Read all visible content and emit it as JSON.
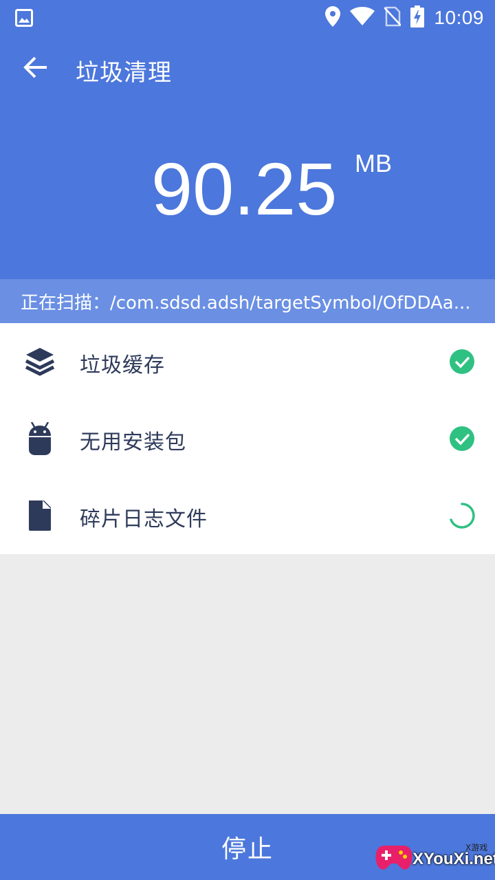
{
  "status_bar": {
    "time": "10:09",
    "icons": [
      "image-icon",
      "location-icon",
      "wifi-icon",
      "no-sim-icon",
      "battery-charging-icon"
    ]
  },
  "toolbar": {
    "title": "垃圾清理",
    "back_icon": "arrow-left-icon"
  },
  "scan_result": {
    "size_value": "90.25",
    "size_unit": "MB"
  },
  "scanning": {
    "text": "正在扫描：/com.sdsd.adsh/targetSymbol/OfDDAa..."
  },
  "items": [
    {
      "label": "垃圾缓存",
      "icon": "layers-icon",
      "status": "done"
    },
    {
      "label": "无用安装包",
      "icon": "android-icon",
      "status": "done"
    },
    {
      "label": "碎片日志文件",
      "icon": "file-icon",
      "status": "loading"
    }
  ],
  "footer": {
    "stop_label": "停止"
  },
  "watermark": {
    "brand": "XYouXi.net",
    "small": "X游戏"
  },
  "colors": {
    "primary": "#4c77dc",
    "scan_bar": "#6a8fe3",
    "success": "#2fc182",
    "icon": "#2e3a5a",
    "background": "#ececec"
  }
}
